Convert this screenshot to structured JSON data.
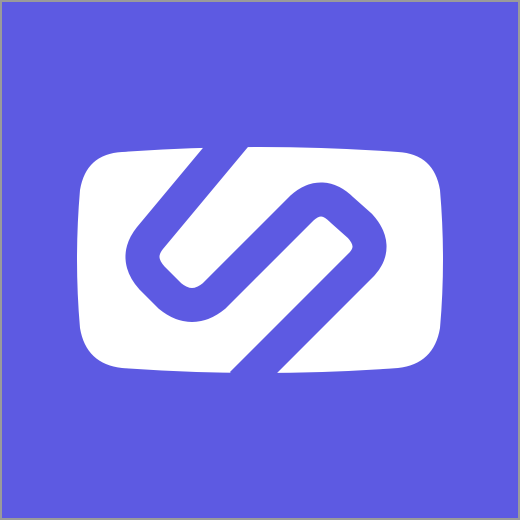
{
  "app_icon": {
    "name": "app-logo",
    "background_color": "#5d5ae2",
    "foreground_color": "#ffffff",
    "border_color": "#9a9a9a",
    "icon": "s-loop-in-rounded-rect-icon"
  }
}
